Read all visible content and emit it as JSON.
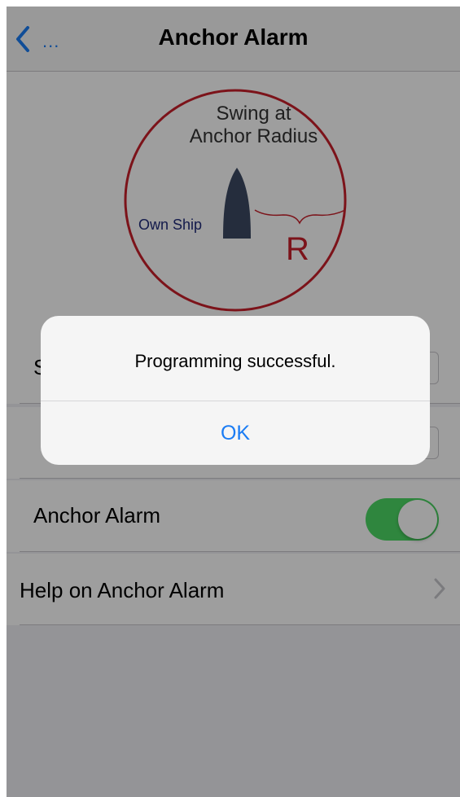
{
  "navbar": {
    "back_label": "...",
    "title": "Anchor Alarm"
  },
  "illustration": {
    "line1": "Swing at",
    "line2": "Anchor Radius",
    "own_ship": "Own Ship",
    "radius_letter": "R",
    "circle_color": "#c8202a",
    "ship_color": "#3d4a63",
    "label_color": "#1f2a7a"
  },
  "rows": {
    "first_label_partial": "S",
    "anchor_alarm_label": "Anchor Alarm",
    "anchor_alarm_on": true,
    "help_label": "Help on Anchor Alarm"
  },
  "alert": {
    "message": "Programming successful.",
    "ok_label": "OK"
  },
  "colors": {
    "accent": "#1a7cf4",
    "toggle_on": "#4cd964"
  }
}
